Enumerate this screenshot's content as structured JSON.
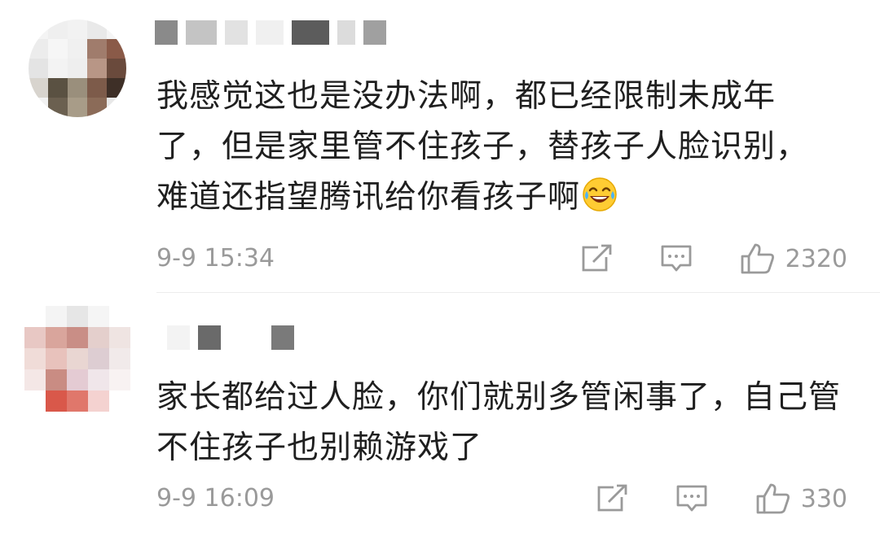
{
  "comments": [
    {
      "content": "我感觉这也是没办法啊，都已经限制未成年了，但是家里管不住孩子，替孩子人脸识别，难道还指望腾讯给你看孩子啊",
      "emoji": "laugh-crying-emoji",
      "time": "9-9 15:34",
      "likes": "2320"
    },
    {
      "content": "家长都给过人脸，你们就别多管闲事了，自己管不住孩子也别赖游戏了",
      "time": "9-9 16:09",
      "likes": "330"
    }
  ],
  "icons": {
    "share": "share-icon",
    "reply": "comment-icon",
    "like": "thumbs-up-icon"
  },
  "colors": {
    "text": "#1f1f1f",
    "meta": "#9a9a9a",
    "background": "#ffffff"
  }
}
